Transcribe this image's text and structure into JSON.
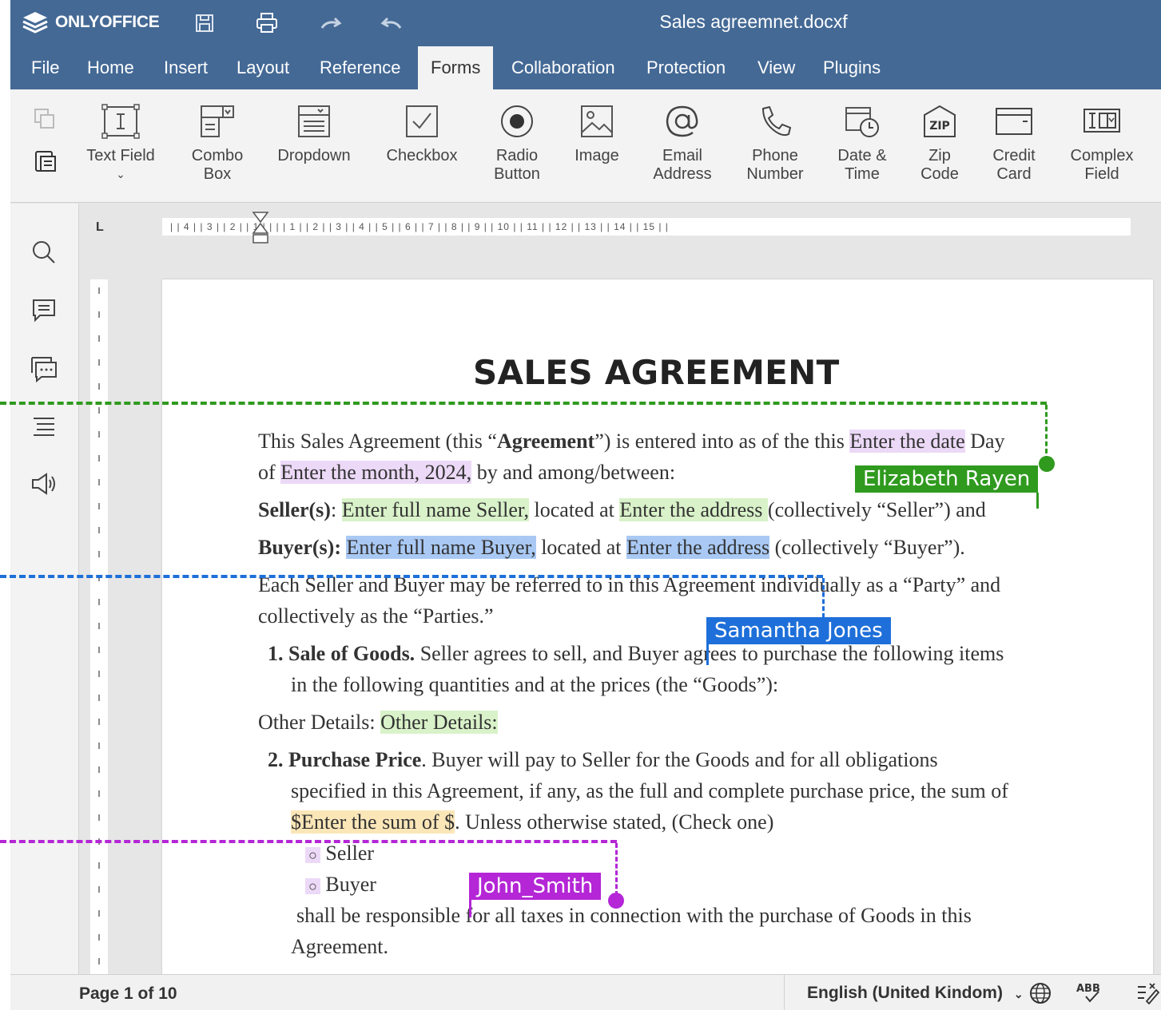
{
  "app": {
    "logo": "ONLYOFFICE",
    "doc_title": "Sales agreemnet.docxf"
  },
  "menu": [
    "File",
    "Home",
    "Insert",
    "Layout",
    "Reference",
    "Forms",
    "Collaboration",
    "Protection",
    "View",
    "Plugins"
  ],
  "active_tab": "Forms",
  "toolbar": {
    "text_field": "Text Field",
    "combo_1": "Combo",
    "combo_2": "Box",
    "dropdown": "Dropdown",
    "checkbox": "Checkbox",
    "radio_1": "Radio",
    "radio_2": "Button",
    "image": "Image",
    "email_1": "Email",
    "email_2": "Address",
    "phone_1": "Phone",
    "phone_2": "Number",
    "date_1": "Date &",
    "date_2": "Time",
    "zip_1": "Zip",
    "zip_2": "Code",
    "card_1": "Credit",
    "card_2": "Card",
    "complex_1": "Complex",
    "complex_2": "Field",
    "zip_icon_text": "ZIP"
  },
  "ruler": {
    "corner": "L",
    "h_text": "|  | 4 |  | 3 |  | 2 |  | 1 |  |    |  | 1 |  | 2 |  | 3 |  | 4 |  | 5 |  | 6 |  | 7 |  | 8 |  | 9 |  | 10 |  | 11 |  | 12 |  | 13 |  | 14 |  | 15 |  |"
  },
  "document": {
    "title": "SALES AGREEMENT",
    "p1a": "This Sales Agreement (this “",
    "p1b": "Agreement",
    "p1c": "”) is entered into as of the this ",
    "f_date": "Enter the date",
    "p1d": " Day",
    "p2a": "of ",
    "f_month": "Enter the month, 2024,",
    "p2b": "  by and among/between:",
    "seller_label": "Seller(s)",
    "seller_colon": ": ",
    "f_seller_name": "Enter full name Seller,",
    "located_1": " located at ",
    "f_seller_addr": "Enter the address ",
    "seller_tail": " (collectively “Seller”) and",
    "buyer_label": "Buyer(s):",
    "f_buyer_name": "Enter full name Buyer,",
    "located_2": " located at ",
    "f_buyer_addr": "Enter the address",
    "buyer_tail": "  (collectively “Buyer”).",
    "p_each": "Each Seller and Buyer may be referred to in this Agreement individually as a “Party” and",
    "p_coll": "collectively as the “Parties.”",
    "n1": "1.",
    "sale_title": "Sale of Goods.",
    "sale_text": " Seller agrees to sell, and Buyer agrees to purchase the following items",
    "sale_text2": "in the following quantities and at the prices (the “Goods”):",
    "other_label": "Other Details: ",
    "f_other": "Other Details:",
    "n2": "2.",
    "price_title": "Purchase Price",
    "price_text": ". Buyer will pay to Seller for the Goods and for all obligations",
    "price_text2": "specified in this Agreement, if any, as the full and complete purchase price, the sum of",
    "f_sum": "$Enter the sum of $",
    "price_tail": ". Unless otherwise stated, (Check one)",
    "opt_seller": "Seller",
    "opt_buyer": "Buyer",
    "resp": "shall be responsible for all taxes in connection with the purchase of Goods in this",
    "resp2": "Agreement."
  },
  "collaborators": {
    "green": {
      "name": "Elizabeth Rayen",
      "color": "#2f9a1e"
    },
    "blue": {
      "name": "Samantha Jones",
      "color": "#1e6fd9"
    },
    "purple": {
      "name": "John_Smith",
      "color": "#b426d6"
    }
  },
  "status": {
    "page": "Page 1 of 10",
    "language": "English (United Kindom)"
  }
}
